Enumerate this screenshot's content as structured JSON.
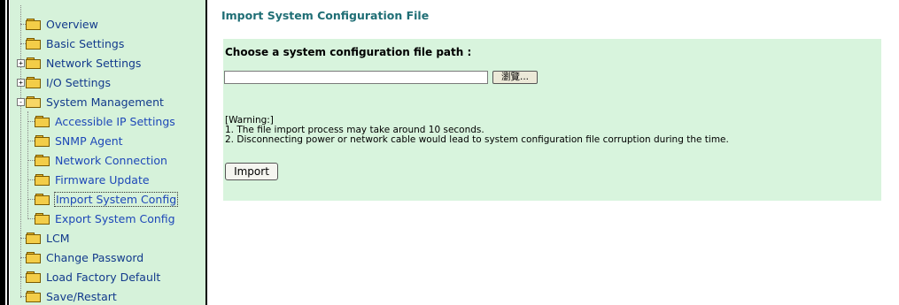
{
  "sidebar": {
    "items": [
      {
        "label": "Overview",
        "level": "top"
      },
      {
        "label": "Basic Settings",
        "level": "top"
      },
      {
        "label": "Network Settings",
        "level": "top",
        "expander": "+"
      },
      {
        "label": "I/O Settings",
        "level": "top",
        "expander": "+"
      },
      {
        "label": "System Management",
        "level": "top",
        "expander": "-",
        "open": true
      },
      {
        "label": "Accessible IP Settings",
        "level": "child"
      },
      {
        "label": "SNMP Agent",
        "level": "child"
      },
      {
        "label": "Network Connection",
        "level": "child"
      },
      {
        "label": "Firmware Update",
        "level": "child"
      },
      {
        "label": "Import System Config",
        "level": "child",
        "selected": true
      },
      {
        "label": "Export System Config",
        "level": "child"
      },
      {
        "label": "LCM",
        "level": "top"
      },
      {
        "label": "Change Password",
        "level": "top"
      },
      {
        "label": "Load Factory Default",
        "level": "top"
      },
      {
        "label": "Save/Restart",
        "level": "top"
      }
    ]
  },
  "main": {
    "title": "Import System Configuration File",
    "panel_heading": "Choose a system configuration file path :",
    "file_path_value": "",
    "browse_label": "瀏覽...",
    "warning_lines": [
      "[Warning:]",
      "1. The file import process may take around 10 seconds.",
      "2. Disconnecting power or network cable would lead to system configuration file corruption during the time."
    ],
    "import_label": "Import"
  },
  "colors": {
    "sidebar_bg": "#d6f2da",
    "panel_bg": "#d8f4dd",
    "title_color": "#1f6e75",
    "link_color": "#1d47b8"
  }
}
